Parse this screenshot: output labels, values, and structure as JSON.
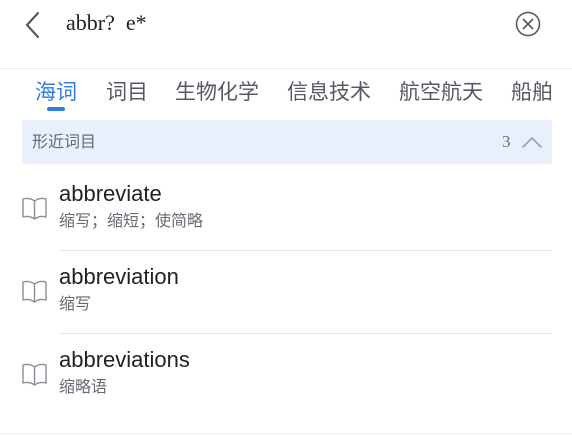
{
  "search": {
    "query": "abbr?  e*"
  },
  "icons": {
    "back": "chevron-left-icon",
    "clear": "clear-circle-icon",
    "collapse": "chevron-up-icon",
    "entry": "book-icon"
  },
  "tabs": [
    {
      "label": "海词",
      "active": true
    },
    {
      "label": "词目"
    },
    {
      "label": "生物化学"
    },
    {
      "label": "信息技术"
    },
    {
      "label": "航空航天"
    },
    {
      "label": "船舶"
    }
  ],
  "section": {
    "title": "形近词目",
    "count": "3"
  },
  "results": [
    {
      "word": "abbreviate",
      "meaning": "缩写；缩短；使简略"
    },
    {
      "word": "abbreviation",
      "meaning": "缩写"
    },
    {
      "word": "abbreviations",
      "meaning": "缩略语"
    }
  ],
  "colors": {
    "accent": "#2f7de1",
    "section_bg": "#e9f0fb",
    "text_primary": "#222222",
    "text_secondary": "#666b73"
  }
}
